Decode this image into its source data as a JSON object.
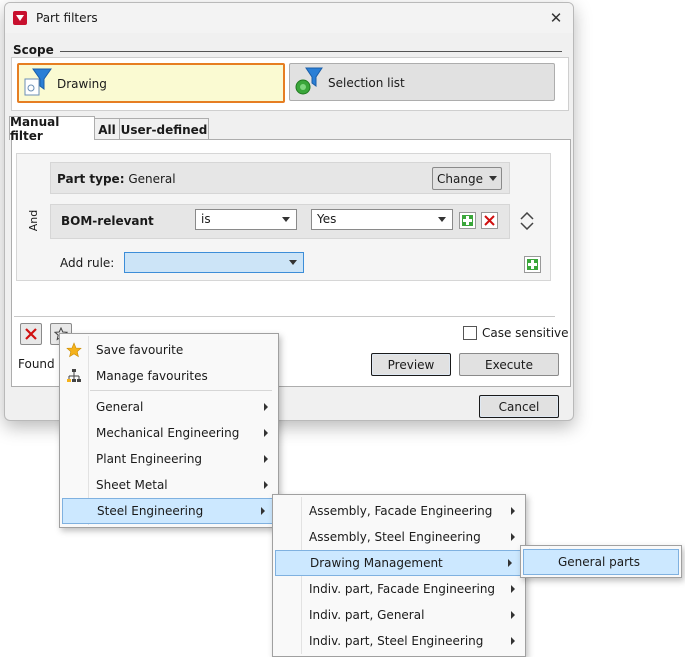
{
  "window": {
    "title": "Part filters"
  },
  "scope": {
    "label": "Scope",
    "drawing": "Drawing",
    "selection_list": "Selection list"
  },
  "tabs": [
    "Manual filter",
    "All",
    "User-defined"
  ],
  "part_type": {
    "label": "Part type:",
    "value": "General",
    "change_label": "Change"
  },
  "rule": {
    "connector": "And",
    "field": "BOM-relevant",
    "operator": "is",
    "value": "Yes"
  },
  "add_rule": {
    "label": "Add rule:",
    "value": ""
  },
  "case_sensitive": {
    "label": "Case sensitive",
    "checked": false
  },
  "found_label": "Found p",
  "buttons": {
    "preview": "Preview",
    "execute": "Execute",
    "cancel": "Cancel"
  },
  "context_menu": {
    "items": [
      {
        "label": "Save favourite",
        "icon": "star-icon"
      },
      {
        "label": "Manage favourites",
        "icon": "tree-icon"
      },
      {
        "label": "General",
        "submenu": true
      },
      {
        "label": "Mechanical Engineering",
        "submenu": true
      },
      {
        "label": "Plant Engineering",
        "submenu": true
      },
      {
        "label": "Sheet Metal",
        "submenu": true
      },
      {
        "label": "Steel Engineering",
        "submenu": true,
        "highlighted": true
      }
    ]
  },
  "submenu": {
    "items": [
      {
        "label": "Assembly, Facade Engineering",
        "submenu": true
      },
      {
        "label": "Assembly, Steel Engineering",
        "submenu": true
      },
      {
        "label": "Drawing Management",
        "submenu": true,
        "highlighted": true
      },
      {
        "label": "Indiv. part, Facade Engineering",
        "submenu": true
      },
      {
        "label": "Indiv. part, General",
        "submenu": true
      },
      {
        "label": "Indiv. part, Steel Engineering",
        "submenu": true
      }
    ]
  },
  "submenu2": {
    "items": [
      {
        "label": "General parts",
        "highlighted": true
      }
    ]
  },
  "colors": {
    "accent_orange": "#e67e22",
    "highlight_blue": "#cce8ff",
    "drawing_bg": "#fafad2"
  }
}
